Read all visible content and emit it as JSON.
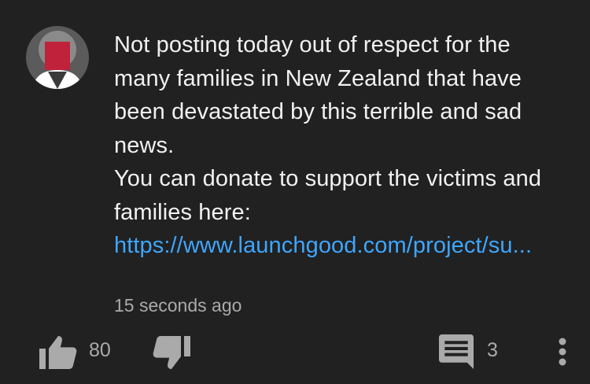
{
  "comment": {
    "author_avatar": "avatar-icon",
    "text_line1": "Not posting today out of respect for the many families in New Zealand that have been devastated by this terrible and sad news.",
    "text_line2": "You can donate to support the victims and families here:",
    "link_text": "https://www.launchgood.com/project/su...",
    "timestamp": "15 seconds ago"
  },
  "actions": {
    "like_icon": "thumbs-up-icon",
    "like_count": "80",
    "dislike_icon": "thumbs-down-icon",
    "reply_icon": "comment-icon",
    "reply_count": "3",
    "more_icon": "more-vertical-icon"
  },
  "colors": {
    "background": "#212121",
    "text": "#f1f1f1",
    "link": "#3ea6ff",
    "secondary": "#aaaaaa"
  }
}
